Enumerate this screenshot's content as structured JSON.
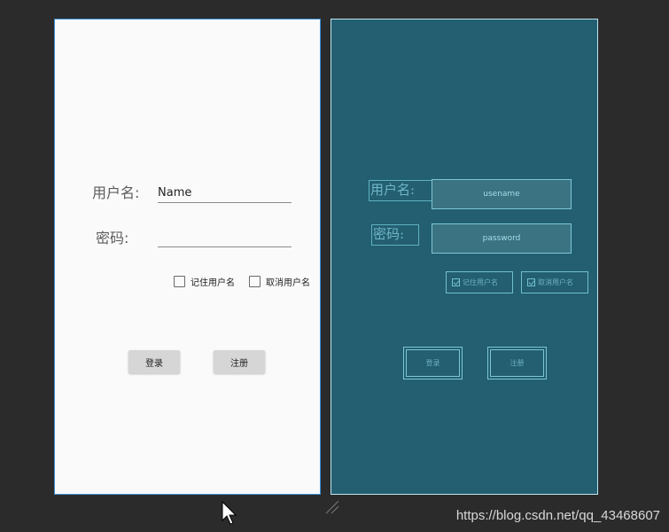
{
  "design": {
    "username_label": "用户名:",
    "password_label": "密码:",
    "username_value": "Name",
    "password_value": "",
    "remember_label": "记住用户名",
    "cancel_label": "取消用户名",
    "login_label": "登录",
    "register_label": "注册"
  },
  "blueprint": {
    "username_label": "用户名:",
    "password_label": "密码:",
    "username_hint": "usename",
    "password_hint": "password",
    "remember_label": "记住用户名",
    "cancel_label": "取消用户名",
    "login_label": "登录",
    "register_label": "注册"
  },
  "watermark": "https://blog.csdn.net/qq_43468607",
  "colors": {
    "canvas": "#2b2b2b",
    "design_bg": "#fafafa",
    "blueprint_bg": "#235f70",
    "selection": "#3d8fd6"
  },
  "icons": [
    "checkbox-icon",
    "mouse-pointer-icon",
    "resize-handle-icon"
  ]
}
